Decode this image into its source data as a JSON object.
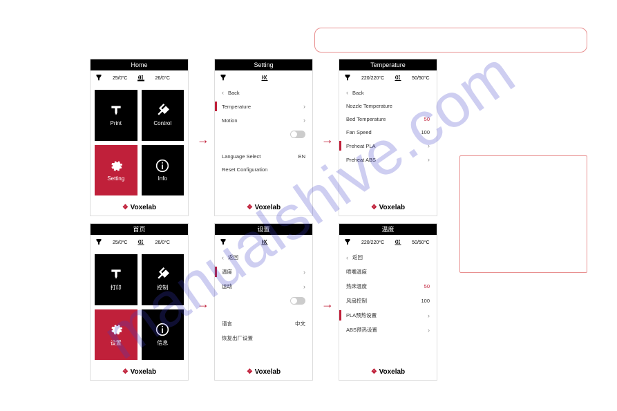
{
  "watermark": "manualshive.com",
  "brand": "Voxelab",
  "arrows": "→",
  "en": {
    "home": {
      "title": "Home",
      "nozzle": "25/0°C",
      "bed": "26/0°C",
      "tiles": {
        "print": "Print",
        "control": "Control",
        "setting": "Setting",
        "info": "Info"
      }
    },
    "setting": {
      "title": "Setting",
      "back": "Back",
      "temperature": "Temperature",
      "motion": "Motion",
      "language_label": "Language Select",
      "language_value": "EN",
      "reset": "Reset Configuration"
    },
    "temperature": {
      "title": "Temperature",
      "nozzle_bar": "220/220°C",
      "bed_bar": "50/50°C",
      "back": "Back",
      "nozzle_temp": "Nozzle Temperature",
      "bed_temp": "Bed Temperature",
      "bed_temp_val": "50",
      "fan": "Fan Speed",
      "fan_val": "100",
      "preheat_pla": "Preheat PLA",
      "preheat_abs": "Preheat ABS"
    }
  },
  "cn": {
    "home": {
      "title": "首页",
      "nozzle": "25/0°C",
      "bed": "26/0°C",
      "tiles": {
        "print": "打印",
        "control": "控制",
        "setting": "设置",
        "info": "信息"
      }
    },
    "setting": {
      "title": "设置",
      "back": "返回",
      "temperature": "温度",
      "motion": "运动",
      "language_label": "语言",
      "language_value": "中文",
      "reset": "恢复出厂设置"
    },
    "temperature": {
      "title": "温度",
      "nozzle_bar": "220/220°C",
      "bed_bar": "50/50°C",
      "back": "返回",
      "nozzle_temp": "喷嘴温度",
      "bed_temp": "热床温度",
      "bed_temp_val": "50",
      "fan": "风扇控制",
      "fan_val": "100",
      "preheat_pla": "PLA预热设置",
      "preheat_abs": "ABS预热设置"
    }
  }
}
